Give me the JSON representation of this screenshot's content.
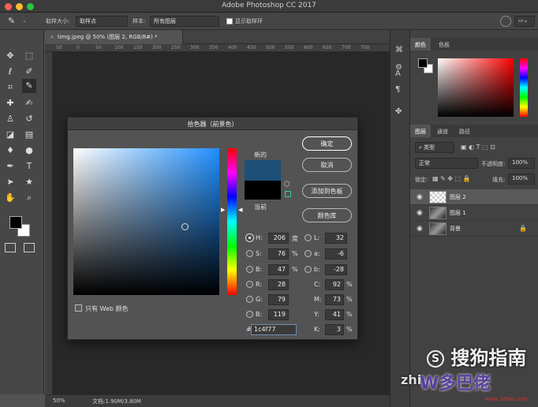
{
  "window": {
    "title": "Adobe Photoshop CC 2017"
  },
  "options_bar": {
    "sample_size_label": "取样大小:",
    "sample_size_value": "取样点",
    "sample_label": "样本:",
    "sample_value": "所有图层",
    "show_ring_label": "显示取样环"
  },
  "document": {
    "tab_label": "timg.jpeg @ 50% (图层 2, RGB/8#) *",
    "rulers": [
      "50",
      "0",
      "50",
      "100",
      "150",
      "200",
      "250",
      "300",
      "350",
      "400",
      "450",
      "500",
      "550",
      "600",
      "650",
      "700",
      "750"
    ],
    "zoom": "50%",
    "doc_info": "文档:1.90M/3.80M"
  },
  "color_panel": {
    "tabs": [
      "颜色",
      "色板"
    ]
  },
  "layers_panel": {
    "tabs": [
      "图层",
      "通道",
      "路径"
    ],
    "filter_label": "类型",
    "blend_mode": "正常",
    "opacity_label": "不透明度:",
    "opacity_value": "100%",
    "lock_label": "锁定:",
    "fill_label": "填充:",
    "fill_value": "100%",
    "layers": [
      {
        "name": "图层 2",
        "selected": true
      },
      {
        "name": "图层 1",
        "selected": false
      },
      {
        "name": "背景",
        "selected": false,
        "locked": true
      }
    ]
  },
  "color_picker": {
    "title": "拾色器（前景色）",
    "new_label": "新的",
    "current_label": "当前",
    "new_color": "#1c4f77",
    "current_color": "#000000",
    "buttons": {
      "ok": "确定",
      "cancel": "取消",
      "add_to_swatches": "添加到色板",
      "color_libraries": "颜色库"
    },
    "web_only_label": "只有 Web 颜色",
    "hsb": {
      "h_label": "H:",
      "h_value": "206",
      "h_unit": "度",
      "s_label": "S:",
      "s_value": "76",
      "s_unit": "%",
      "b_label": "B:",
      "b_value": "47",
      "b_unit": "%"
    },
    "lab": {
      "l_label": "L:",
      "l_value": "32",
      "a_label": "a:",
      "a_value": "-6",
      "b_label": "b:",
      "b_value": "-28"
    },
    "rgb": {
      "r_label": "R:",
      "r_value": "28",
      "g_label": "G:",
      "g_value": "79",
      "b_label": "B:",
      "b_value": "119"
    },
    "cmyk": {
      "c_label": "C:",
      "c_value": "92",
      "m_label": "M:",
      "m_value": "73",
      "y_label": "Y:",
      "y_value": "41",
      "k_label": "K:",
      "k_value": "3",
      "unit": "%"
    },
    "hex_label": "#",
    "hex_value": "1c4f77"
  },
  "watermarks": {
    "sogou": "搜狗指南",
    "site": "zhi",
    "logo": "W多巴佬",
    "url": "www.386w.com"
  },
  "colors": {
    "accent": "#1c4f77",
    "dialog_bg": "#535353"
  }
}
